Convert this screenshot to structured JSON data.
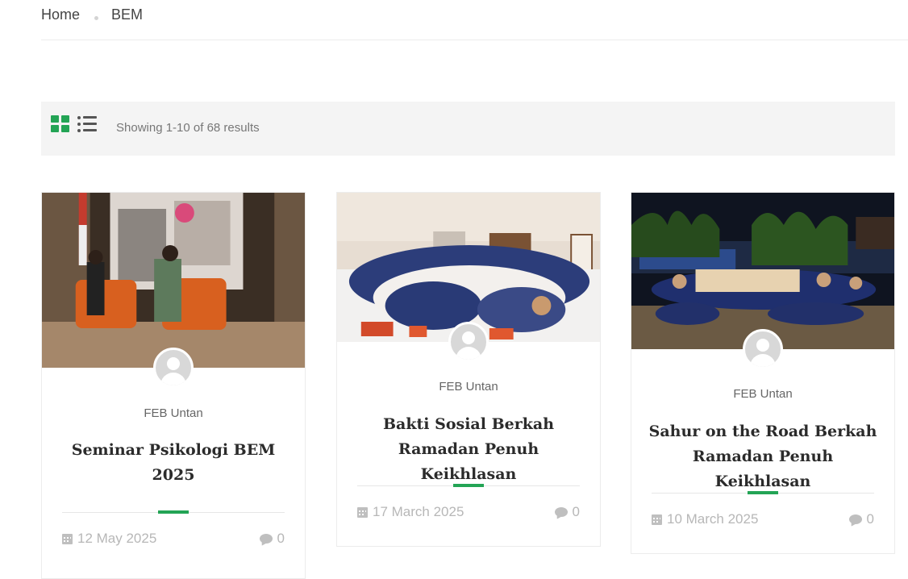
{
  "breadcrumb": {
    "home": "Home",
    "current": "BEM"
  },
  "toolbar": {
    "results_text": "Showing 1-10 of 68 results"
  },
  "colors": {
    "accent": "#23a455",
    "muted": "#b7b7b7"
  },
  "posts": [
    {
      "author": "FEB Untan",
      "title": "Seminar Psikologi BEM 2025",
      "date": "12 May 2025",
      "comments": "0"
    },
    {
      "author": "FEB Untan",
      "title": "Bakti Sosial Berkah Ramadan Penuh Keikhlasan",
      "date": "17 March 2025",
      "comments": "0"
    },
    {
      "author": "FEB Untan",
      "title": "Sahur on the Road Berkah Ramadan Penuh Keikhlasan",
      "date": "10 March 2025",
      "comments": "0"
    }
  ]
}
